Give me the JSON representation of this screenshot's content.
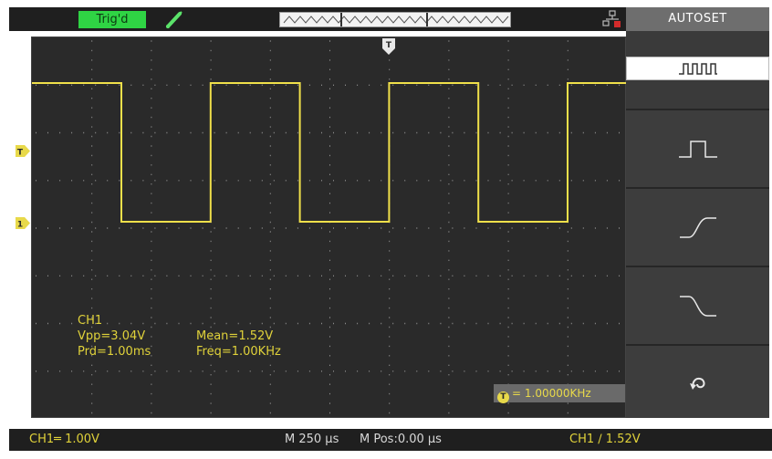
{
  "status_bar": {
    "trigger_status": "Trig'd",
    "probe_icon": "probe-icon",
    "network_icon": "network-icon"
  },
  "measurements": {
    "channel": "CH1",
    "vpp": "Vpp=3.04V",
    "mean": "Mean=1.52V",
    "period": "Prd=1.00ms",
    "frequency": "Freq=1.00KHz"
  },
  "trigger_freq_counter": "= 1.00000KHz",
  "bottom_bar": {
    "ch1_scale": "CH1═ 1.00V",
    "timebase": "M 250 µs",
    "main_position": "M Pos:0.00 µs",
    "trigger_info": "CH1 ∕ 1.52V"
  },
  "menu": {
    "title": "AUTOSET",
    "buttons": [
      {
        "icon": "multi-period-icon",
        "selected": true
      },
      {
        "icon": "single-period-icon",
        "selected": false
      },
      {
        "icon": "rising-edge-icon",
        "selected": false
      },
      {
        "icon": "falling-edge-icon",
        "selected": false
      },
      {
        "icon": "undo-icon",
        "selected": false
      }
    ]
  },
  "colors": {
    "screen_bg": "#2a2a2a",
    "trace": "#f0e04a",
    "trigger_ok": "#2fd444",
    "menu_bg": "#3a3a3a"
  }
}
